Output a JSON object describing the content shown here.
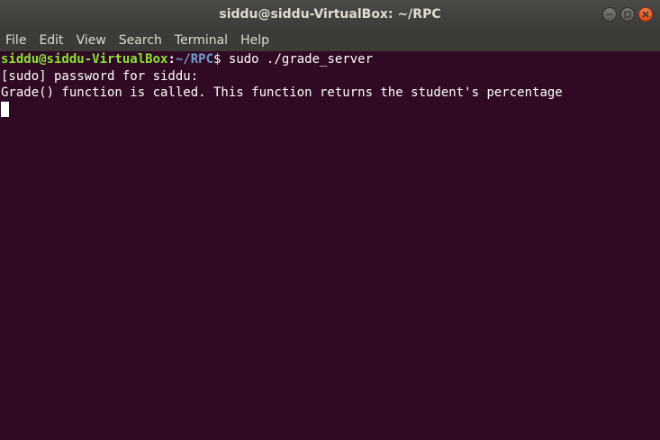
{
  "window": {
    "title": "siddu@siddu-VirtualBox: ~/RPC"
  },
  "menu": {
    "items": [
      "File",
      "Edit",
      "View",
      "Search",
      "Terminal",
      "Help"
    ]
  },
  "terminal": {
    "prompt_user": "siddu@siddu-VirtualBox",
    "prompt_colon": ":",
    "prompt_path": "~/RPC",
    "prompt_suffix": "$ ",
    "command": "sudo ./grade_server",
    "output": [
      "[sudo] password for siddu:",
      "Grade() function is called. This function returns the student's percentage"
    ]
  },
  "colors": {
    "terminal_background": "#300a24",
    "prompt_user": "#8ae234",
    "prompt_path": "#729fcf",
    "titlebar": "#3c3b37",
    "close_button": "#df4a16"
  },
  "icons": {
    "minimize": "minimize-icon",
    "maximize": "maximize-icon",
    "close": "close-icon"
  }
}
